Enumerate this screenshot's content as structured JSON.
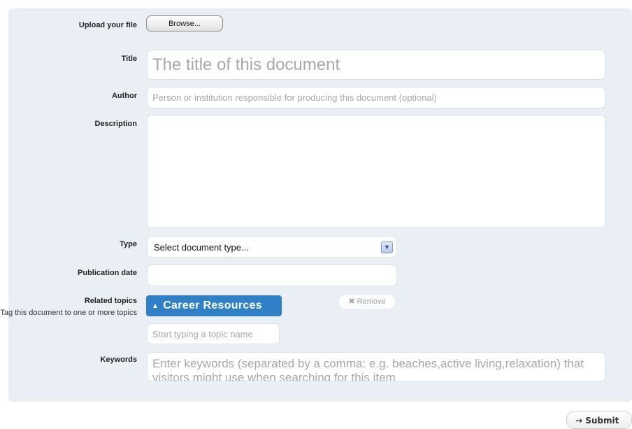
{
  "form": {
    "upload": {
      "label": "Upload your file",
      "button": "Browse..."
    },
    "title": {
      "label": "Title",
      "placeholder": "The title of this document",
      "value": ""
    },
    "author": {
      "label": "Author",
      "placeholder": "Person or institution responsible for producing this document (optional)",
      "value": ""
    },
    "description": {
      "label": "Description",
      "value": ""
    },
    "type": {
      "label": "Type",
      "selected": "Select document type..."
    },
    "publication_date": {
      "label": "Publication date",
      "value": ""
    },
    "related_topics": {
      "label": "Related topics",
      "help": "Tag this document to one or more topics",
      "selected_topic": "Career Resources",
      "remove_label": "✖ Remove",
      "search_placeholder": "Start typing a topic name"
    },
    "keywords": {
      "label": "Keywords",
      "placeholder": "Enter keywords (separated by a comma: e.g. beaches,active living,relaxation) that visitors might use when searching for this item"
    }
  },
  "actions": {
    "submit_label": "→ Submit"
  },
  "colors": {
    "panel": "#e9eff4",
    "topic_tag": "#2f80c6"
  }
}
